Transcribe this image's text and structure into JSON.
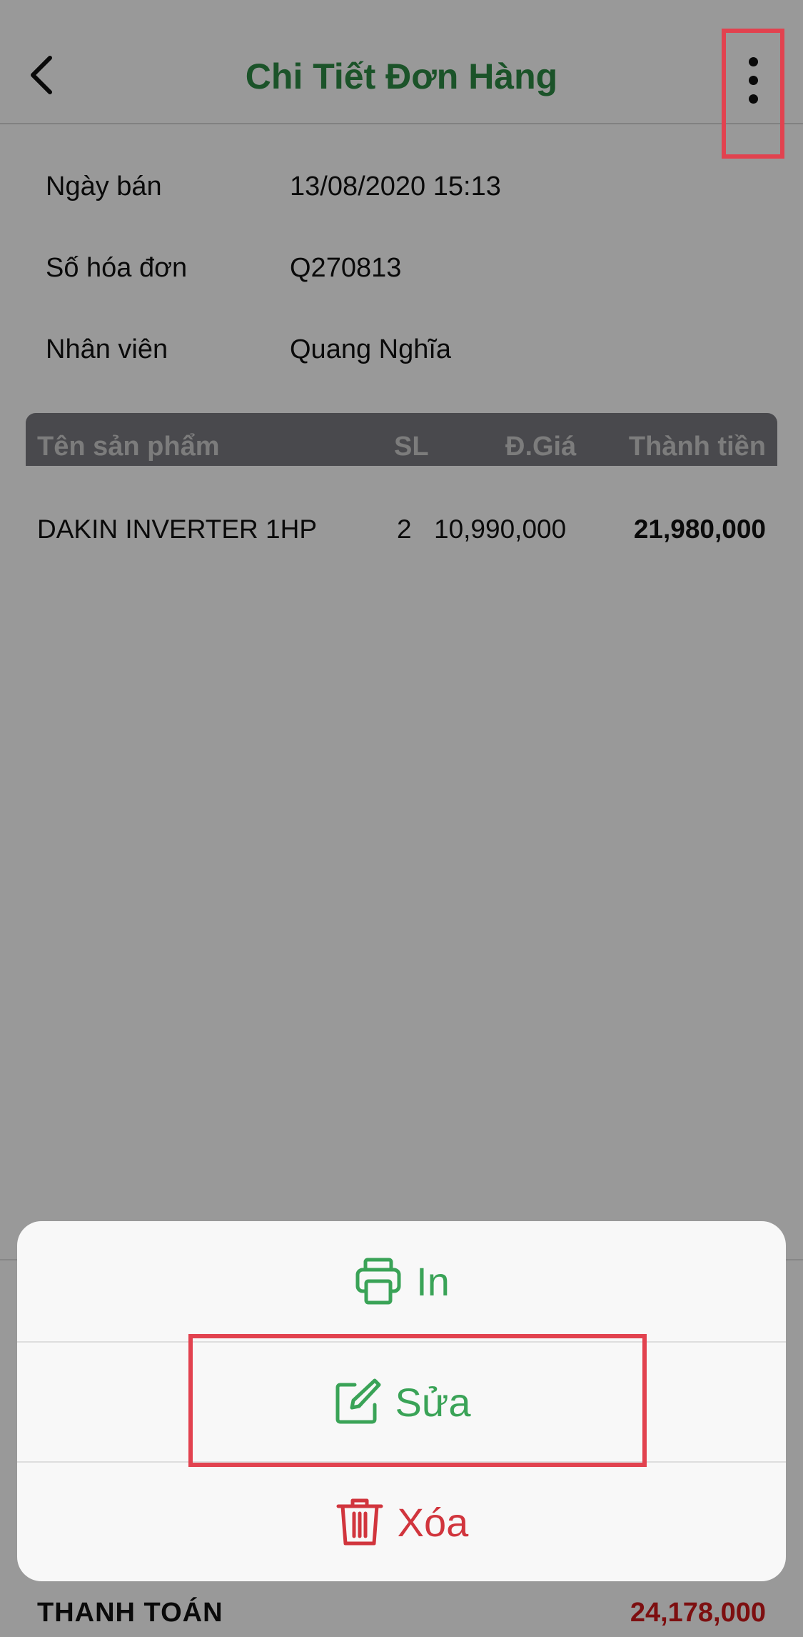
{
  "header": {
    "title": "Chi Tiết Đơn Hàng"
  },
  "info": [
    {
      "label": "Ngày bán",
      "value": "13/08/2020 15:13"
    },
    {
      "label": "Số hóa đơn",
      "value": "Q270813"
    },
    {
      "label": "Nhân viên",
      "value": "Quang Nghĩa"
    }
  ],
  "table": {
    "headers": {
      "name": "Tên sản phẩm",
      "qty": "SL",
      "price": "Đ.Giá",
      "total": "Thành tiền"
    },
    "rows": [
      {
        "name": "DAKIN INVERTER 1HP",
        "qty": "2",
        "price": "10,990,000",
        "total": "21,980,000"
      }
    ]
  },
  "footer": {
    "pay_label": "THANH TOÁN",
    "pay_value": "24,178,000"
  },
  "sheet": {
    "print_label": "In",
    "edit_label": "Sửa",
    "delete_label": "Xóa"
  },
  "colors": {
    "brand_green": "#2e8b45",
    "action_green": "#3aa357",
    "danger_red": "#d1353d",
    "highlight": "#e2424f"
  },
  "icons": {
    "back": "chevron-left-icon",
    "more": "more-vertical-icon",
    "print": "printer-icon",
    "edit": "edit-icon",
    "delete": "trash-icon"
  }
}
